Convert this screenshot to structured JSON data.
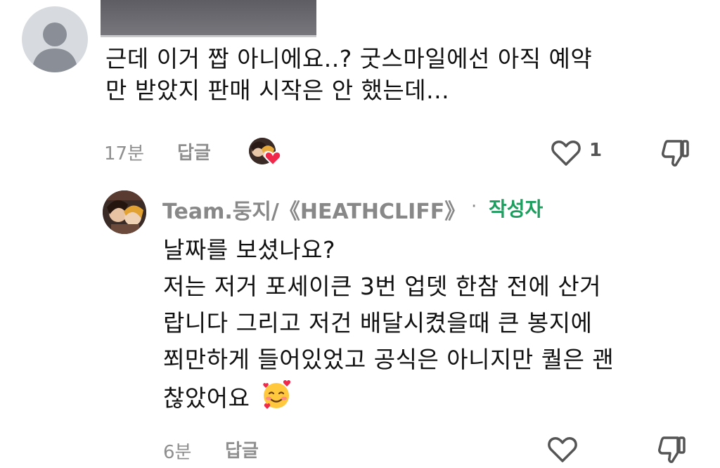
{
  "comment": {
    "lines": [
      "근데 이거 짭 아니에요..? 굿스마일에선 아직 예약",
      "만 받았지 판매 시작은 안 했는데..."
    ],
    "time": "17분",
    "reply_label": "답글",
    "like_count": "1"
  },
  "reply": {
    "author": "Team.둥지/《HEATHCLIFF》",
    "separator": "·",
    "badge": "작성자",
    "lines": [
      "날짜를 보셨나요?",
      "저는 저거 포세이큰 3번 업뎃 한참 전에 산거",
      "랍니다 그리고 저건 배달시켰을때 큰 봉지에",
      "쬐만하게 들어있었고 공식은 아니지만 퀄은 괜",
      "찮았어요"
    ],
    "time": "6분",
    "reply_label": "답글"
  },
  "icons": {
    "heart": "heart-outline-icon",
    "dislike": "thumbs-down-icon",
    "emoji": "smiling-face-with-hearts-emoji",
    "reaction": "red-heart-reaction-icon"
  },
  "colors": {
    "author_badge": "#1d9e5f",
    "meta_gray": "#8f8f8f",
    "icon_gray": "#555555",
    "reaction_red": "#f02849"
  }
}
